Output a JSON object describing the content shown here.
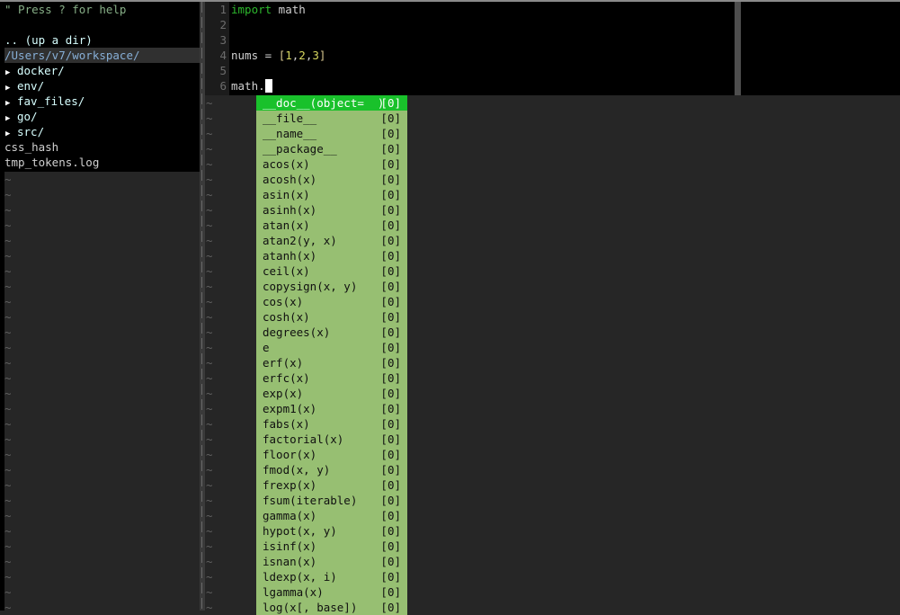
{
  "file_tree": {
    "help_text": "\" Press ? for help",
    "up_dir": ".. (up a dir)",
    "current_dir": "/Users/v7/workspace/",
    "entries": [
      {
        "name": "docker/",
        "type": "dir",
        "icon": "triangle-right-icon"
      },
      {
        "name": "env/",
        "type": "dir",
        "icon": "triangle-right-icon"
      },
      {
        "name": "fav_files/",
        "type": "dir",
        "icon": "triangle-right-icon"
      },
      {
        "name": "go/",
        "type": "dir",
        "icon": "triangle-right-icon"
      },
      {
        "name": "src/",
        "type": "dir",
        "icon": "triangle-right-icon"
      },
      {
        "name": "css_hash",
        "type": "file"
      },
      {
        "name": "tmp_tokens.log",
        "type": "file"
      }
    ],
    "empty_line_marker": "~"
  },
  "editor": {
    "lines": [
      {
        "number": "1",
        "text": "import math"
      },
      {
        "number": "2",
        "text": ""
      },
      {
        "number": "3",
        "text": ""
      },
      {
        "number": "4",
        "text": "nums = [1,2,3]"
      },
      {
        "number": "5",
        "text": ""
      },
      {
        "number": "6",
        "text": "math."
      }
    ],
    "tokens": {
      "import_kw": "import",
      "import_mod": " math",
      "nums_lhs": "nums = ",
      "lbr": "[",
      "n1": "1",
      "c1": ",",
      "n2": "2",
      "c2": ",",
      "n3": "3",
      "rbr": "]",
      "math_dot": "math."
    },
    "empty_line_marker": "~"
  },
  "completion_popup": {
    "selected_index": 0,
    "items": [
      {
        "word": "__doc__(object=  )",
        "kind": "[0]"
      },
      {
        "word": "__file__",
        "kind": "[0]"
      },
      {
        "word": "__name__",
        "kind": "[0]"
      },
      {
        "word": "__package__",
        "kind": "[0]"
      },
      {
        "word": "acos(x)",
        "kind": "[0]"
      },
      {
        "word": "acosh(x)",
        "kind": "[0]"
      },
      {
        "word": "asin(x)",
        "kind": "[0]"
      },
      {
        "word": "asinh(x)",
        "kind": "[0]"
      },
      {
        "word": "atan(x)",
        "kind": "[0]"
      },
      {
        "word": "atan2(y, x)",
        "kind": "[0]"
      },
      {
        "word": "atanh(x)",
        "kind": "[0]"
      },
      {
        "word": "ceil(x)",
        "kind": "[0]"
      },
      {
        "word": "copysign(x, y)",
        "kind": "[0]"
      },
      {
        "word": "cos(x)",
        "kind": "[0]"
      },
      {
        "word": "cosh(x)",
        "kind": "[0]"
      },
      {
        "word": "degrees(x)",
        "kind": "[0]"
      },
      {
        "word": "e",
        "kind": "[0]"
      },
      {
        "word": "erf(x)",
        "kind": "[0]"
      },
      {
        "word": "erfc(x)",
        "kind": "[0]"
      },
      {
        "word": "exp(x)",
        "kind": "[0]"
      },
      {
        "word": "expm1(x)",
        "kind": "[0]"
      },
      {
        "word": "fabs(x)",
        "kind": "[0]"
      },
      {
        "word": "factorial(x)",
        "kind": "[0]"
      },
      {
        "word": "floor(x)",
        "kind": "[0]"
      },
      {
        "word": "fmod(x, y)",
        "kind": "[0]"
      },
      {
        "word": "frexp(x)",
        "kind": "[0]"
      },
      {
        "word": "fsum(iterable)",
        "kind": "[0]"
      },
      {
        "word": "gamma(x)",
        "kind": "[0]"
      },
      {
        "word": "hypot(x, y)",
        "kind": "[0]"
      },
      {
        "word": "isinf(x)",
        "kind": "[0]"
      },
      {
        "word": "isnan(x)",
        "kind": "[0]"
      },
      {
        "word": "ldexp(x, i)",
        "kind": "[0]"
      },
      {
        "word": "lgamma(x)",
        "kind": "[0]"
      },
      {
        "word": "log(x[, base])",
        "kind": "[0]"
      }
    ]
  },
  "colors": {
    "popup_bg": "#97bf72",
    "popup_selected_bg": "#19c12b",
    "keyword": "#2db82d",
    "number": "#d7d75f",
    "background": "#262626"
  }
}
